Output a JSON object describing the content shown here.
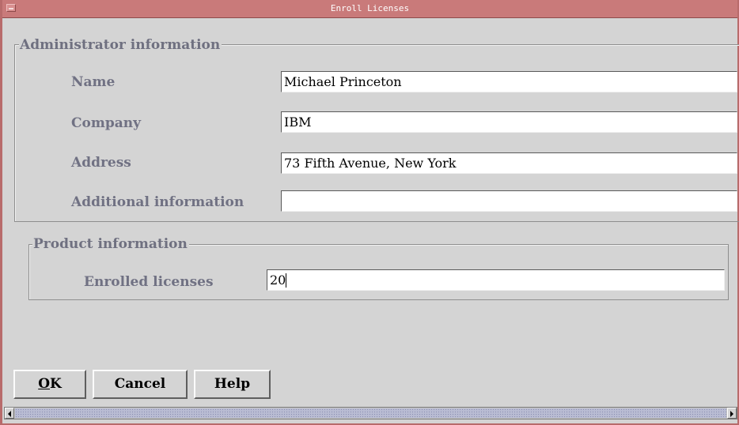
{
  "window": {
    "title": "Enroll Licenses",
    "titlebar_color": "#c97a7a"
  },
  "admin": {
    "legend": "Administrator information",
    "name_label": "Name",
    "name_value": "Michael Princeton",
    "company_label": "Company",
    "company_value": "IBM",
    "address_label": "Address",
    "address_value": "73 Fifth Avenue, New York",
    "additional_label": "Additional information",
    "additional_value": ""
  },
  "product": {
    "legend": "Product information",
    "enrolled_label": "Enrolled licenses",
    "enrolled_value": "20"
  },
  "buttons": {
    "ok_mnemonic": "O",
    "ok_rest": "K",
    "cancel": "Cancel",
    "help": "Help"
  },
  "icons": {
    "window_menu": "window-menu-icon",
    "scroll_left": "left-arrow-icon",
    "scroll_right": "right-arrow-icon"
  }
}
